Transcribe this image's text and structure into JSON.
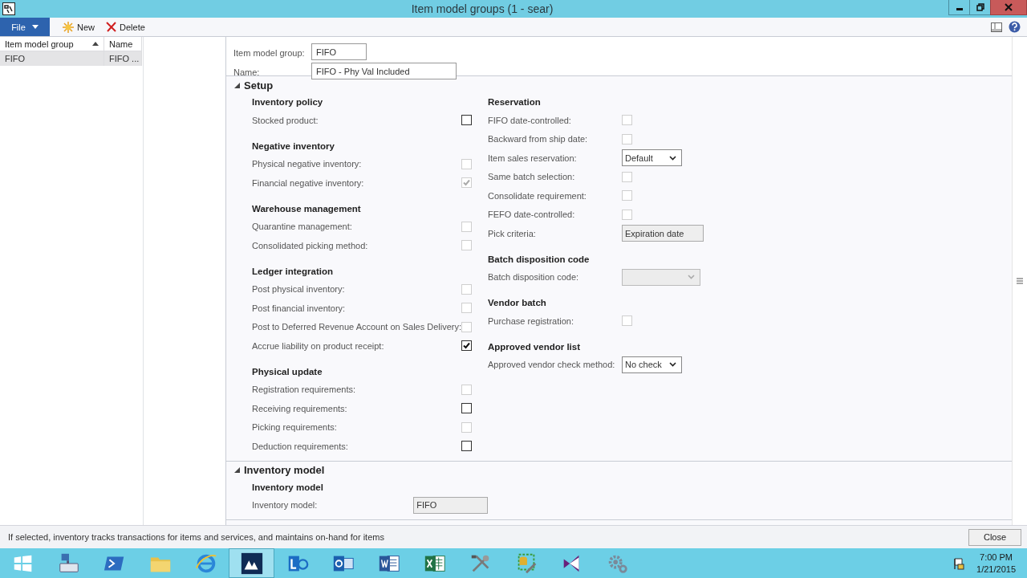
{
  "window": {
    "title": "Item model groups (1 - sear)"
  },
  "toolbar": {
    "file_menu": "File",
    "buttons": [
      {
        "kind": "new",
        "label": "New"
      },
      {
        "kind": "delete",
        "label": "Delete"
      }
    ]
  },
  "list": {
    "columns": [
      {
        "label": "Item model group",
        "sorted": true
      },
      {
        "label": "Name",
        "sorted": false
      }
    ],
    "rows": [
      {
        "cells": [
          "FIFO",
          "FIFO ..."
        ],
        "selected": true
      }
    ]
  },
  "header_fields": [
    {
      "label": "Item model group:",
      "value": "FIFO"
    },
    {
      "label": "Name:",
      "value": "FIFO - Phy Val Included"
    }
  ],
  "sections": [
    {
      "title": "Setup",
      "expanded": true,
      "columns": [
        [
          {
            "heading": "Inventory policy",
            "rows": [
              {
                "kind": "checkbox",
                "label": "Stocked product:",
                "checked": false,
                "disabled": false
              }
            ]
          },
          {
            "heading": "Negative inventory",
            "rows": [
              {
                "kind": "checkbox",
                "label": "Physical negative inventory:",
                "checked": false,
                "disabled": true
              },
              {
                "kind": "checkbox",
                "label": "Financial negative inventory:",
                "checked": true,
                "disabled": true
              }
            ]
          },
          {
            "heading": "Warehouse management",
            "rows": [
              {
                "kind": "checkbox",
                "label": "Quarantine management:",
                "checked": false,
                "disabled": true
              },
              {
                "kind": "checkbox",
                "label": "Consolidated picking method:",
                "checked": false,
                "disabled": true
              }
            ]
          },
          {
            "heading": "Ledger integration",
            "rows": [
              {
                "kind": "checkbox",
                "label": "Post physical inventory:",
                "checked": false,
                "disabled": true
              },
              {
                "kind": "checkbox",
                "label": "Post financial inventory:",
                "checked": false,
                "disabled": true
              },
              {
                "kind": "checkbox",
                "label": "Post to Deferred Revenue Account on Sales Delivery:",
                "checked": false,
                "disabled": true
              },
              {
                "kind": "checkbox",
                "label": "Accrue liability on product receipt:",
                "checked": true,
                "disabled": false
              }
            ]
          },
          {
            "heading": "Physical update",
            "rows": [
              {
                "kind": "checkbox",
                "label": "Registration requirements:",
                "checked": false,
                "disabled": true
              },
              {
                "kind": "checkbox",
                "label": "Receiving requirements:",
                "checked": false,
                "disabled": false
              },
              {
                "kind": "checkbox",
                "label": "Picking requirements:",
                "checked": false,
                "disabled": true
              },
              {
                "kind": "checkbox",
                "label": "Deduction requirements:",
                "checked": false,
                "disabled": false
              }
            ]
          }
        ],
        [
          {
            "heading": "Reservation",
            "rows": [
              {
                "kind": "checkbox",
                "label": "FIFO date-controlled:",
                "checked": false,
                "disabled": true
              },
              {
                "kind": "checkbox",
                "label": "Backward from ship date:",
                "checked": false,
                "disabled": true
              },
              {
                "kind": "select",
                "label": "Item sales reservation:",
                "value": "Default",
                "disabled": false
              },
              {
                "kind": "checkbox",
                "label": "Same batch selection:",
                "checked": false,
                "disabled": true
              },
              {
                "kind": "checkbox",
                "label": "Consolidate requirement:",
                "checked": false,
                "disabled": true
              },
              {
                "kind": "checkbox",
                "label": "FEFO date-controlled:",
                "checked": false,
                "disabled": true
              },
              {
                "kind": "field",
                "label": "Pick criteria:",
                "value": "Expiration date",
                "readonly": true
              }
            ]
          },
          {
            "heading": "Batch disposition code",
            "rows": [
              {
                "kind": "select",
                "label": "Batch disposition code:",
                "disabled": true
              }
            ]
          },
          {
            "heading": "Vendor batch",
            "rows": [
              {
                "kind": "checkbox",
                "label": "Purchase registration:",
                "checked": false,
                "disabled": true
              }
            ]
          },
          {
            "heading": "Approved vendor list",
            "rows": [
              {
                "kind": "select",
                "label": "Approved vendor check method:",
                "value": "No check",
                "disabled": false
              }
            ]
          }
        ]
      ]
    },
    {
      "title": "Inventory model",
      "expanded": true,
      "columns": [
        [
          {
            "heading": "Inventory model",
            "rows": [
              {
                "kind": "field",
                "label": "Inventory model:",
                "value": "FIFO",
                "readonly": true
              }
            ]
          }
        ]
      ]
    }
  ],
  "status_bar": {
    "text": "If selected, inventory tracks transactions for items and services, and maintains on-hand for items",
    "button": "Close"
  },
  "taskbar": {
    "time": "7:00 PM",
    "date": "1/21/2015"
  }
}
